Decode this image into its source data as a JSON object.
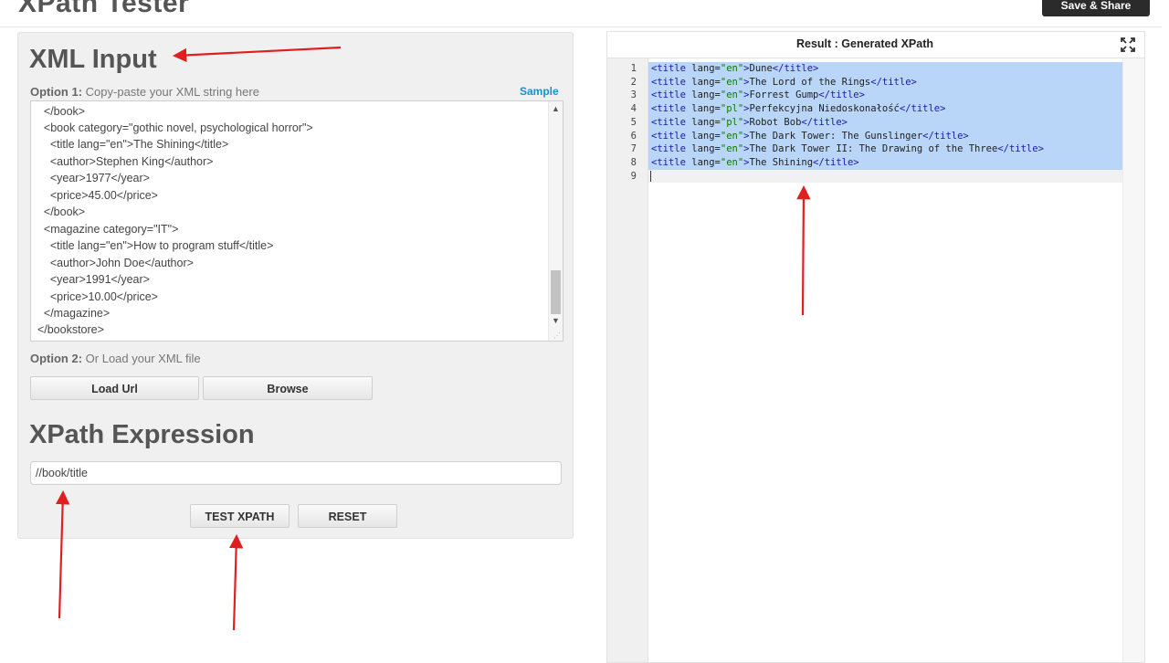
{
  "app": {
    "title": "XPath Tester",
    "save_share_label": "Save & Share"
  },
  "xml_input": {
    "heading": "XML Input",
    "option1_prefix": "Option 1:",
    "option1_text": " Copy-paste your XML string here",
    "sample_link": "Sample",
    "lines": [
      "    </book>",
      "    <book category=\"gothic novel, psychological horror\">",
      "      <title lang=\"en\">The Shining</title>",
      "      <author>Stephen King</author>",
      "      <year>1977</year>",
      "      <price>45.00</price>",
      "    </book>",
      "    <magazine category=\"IT\">",
      "      <title lang=\"en\">How to program stuff</title>",
      "      <author>John Doe</author>",
      "      <year>1991</year>",
      "      <price>10.00</price>",
      "    </magazine>",
      "  </bookstore>"
    ],
    "option2_prefix": "Option 2:",
    "option2_text": " Or Load your XML file",
    "load_url_label": "Load Url",
    "browse_label": "Browse"
  },
  "xpath": {
    "heading": "XPath Expression",
    "value": "//book/title",
    "test_label": "TEST XPATH",
    "reset_label": "RESET"
  },
  "result": {
    "header": "Result : Generated XPath",
    "line_numbers": [
      "1",
      "2",
      "3",
      "4",
      "5",
      "6",
      "7",
      "8",
      "9"
    ],
    "lines": [
      {
        "lang": "en",
        "text": "Dune"
      },
      {
        "lang": "en",
        "text": "The Lord of the Rings"
      },
      {
        "lang": "en",
        "text": "Forrest Gump"
      },
      {
        "lang": "pl",
        "text": "Perfekcyjna Niedoskonałość"
      },
      {
        "lang": "pl",
        "text": "Robot Bob"
      },
      {
        "lang": "en",
        "text": "The Dark Tower: The Gunslinger"
      },
      {
        "lang": "en",
        "text": "The Dark Tower II: The Drawing of the Three"
      },
      {
        "lang": "en",
        "text": "The Shining"
      }
    ]
  },
  "colors": {
    "arrow": "#e02020",
    "selection": "#b9d5f7",
    "link": "#1e90c8"
  }
}
